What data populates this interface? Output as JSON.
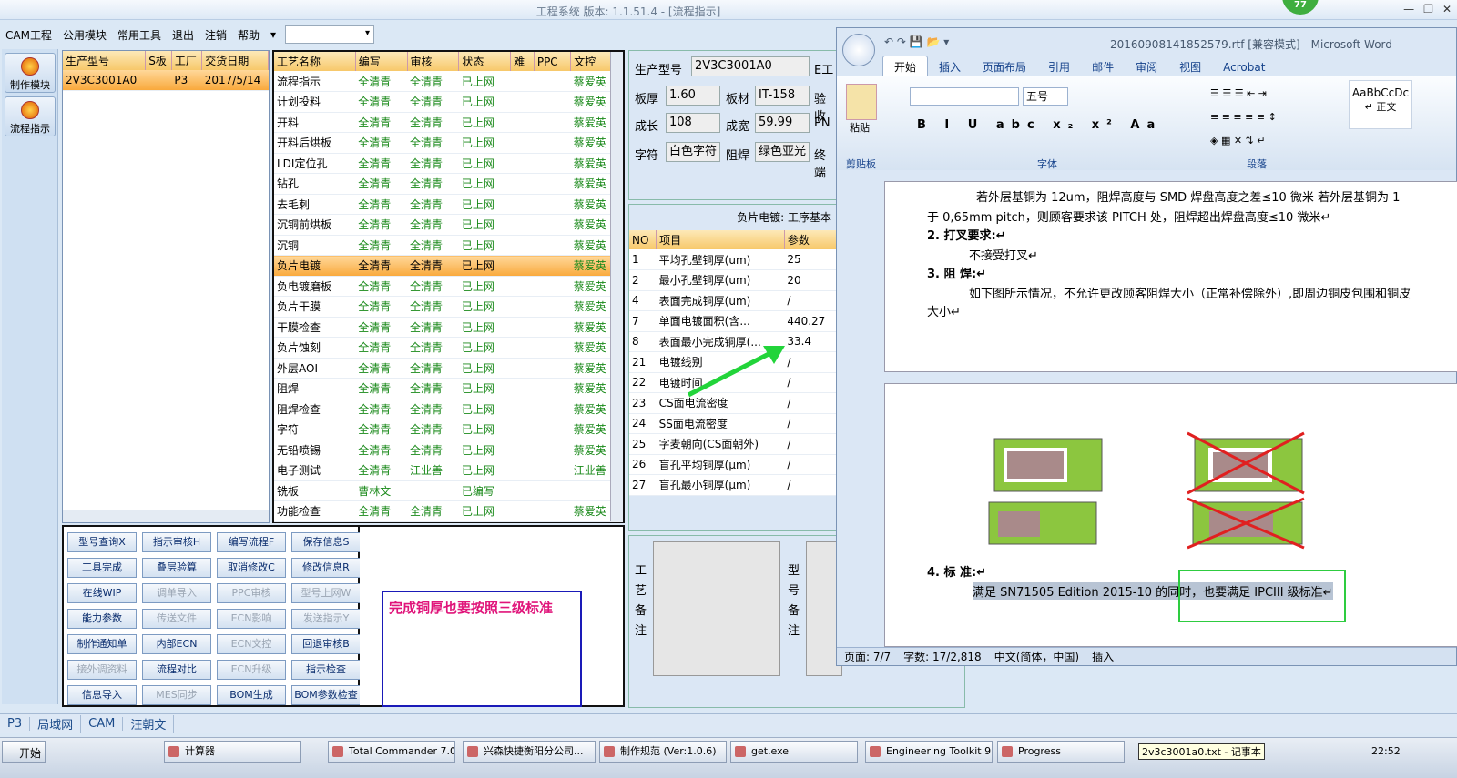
{
  "app": {
    "title": "工程系统  版本: 1.1.51.4 - [流程指示]",
    "badge": "77"
  },
  "menu": [
    "CAM工程",
    "公用模块",
    "常用工具",
    "退出",
    "注销",
    "帮助"
  ],
  "left_tools": [
    {
      "label": "制作模块"
    },
    {
      "label": "流程指示"
    }
  ],
  "model_table": {
    "headers": [
      "生产型号",
      "S板",
      "工厂",
      "交货日期"
    ],
    "row": [
      "2V3C3001A0",
      "",
      "P3",
      "2017/5/14"
    ]
  },
  "process_table": {
    "headers": [
      "工艺名称",
      "编写",
      "审核",
      "状态",
      "难",
      "PPC",
      "文控"
    ],
    "rows": [
      [
        "流程指示",
        "全清青",
        "全清青",
        "已上网",
        "",
        "",
        "蔡爱英"
      ],
      [
        "计划投料",
        "全清青",
        "全清青",
        "已上网",
        "",
        "",
        "蔡爱英"
      ],
      [
        "开料",
        "全清青",
        "全清青",
        "已上网",
        "",
        "",
        "蔡爱英"
      ],
      [
        "开料后烘板",
        "全清青",
        "全清青",
        "已上网",
        "",
        "",
        "蔡爱英"
      ],
      [
        "LDI定位孔",
        "全清青",
        "全清青",
        "已上网",
        "",
        "",
        "蔡爱英"
      ],
      [
        "钻孔",
        "全清青",
        "全清青",
        "已上网",
        "",
        "",
        "蔡爱英"
      ],
      [
        "去毛刺",
        "全清青",
        "全清青",
        "已上网",
        "",
        "",
        "蔡爱英"
      ],
      [
        "沉铜前烘板",
        "全清青",
        "全清青",
        "已上网",
        "",
        "",
        "蔡爱英"
      ],
      [
        "沉铜",
        "全清青",
        "全清青",
        "已上网",
        "",
        "",
        "蔡爱英"
      ],
      [
        "负片电镀",
        "全清青",
        "全清青",
        "已上网",
        "",
        "",
        "蔡爱英"
      ],
      [
        "负电镀磨板",
        "全清青",
        "全清青",
        "已上网",
        "",
        "",
        "蔡爱英"
      ],
      [
        "负片干膜",
        "全清青",
        "全清青",
        "已上网",
        "",
        "",
        "蔡爱英"
      ],
      [
        "干膜检查",
        "全清青",
        "全清青",
        "已上网",
        "",
        "",
        "蔡爱英"
      ],
      [
        "负片蚀刻",
        "全清青",
        "全清青",
        "已上网",
        "",
        "",
        "蔡爱英"
      ],
      [
        "外层AOI",
        "全清青",
        "全清青",
        "已上网",
        "",
        "",
        "蔡爱英"
      ],
      [
        "阻焊",
        "全清青",
        "全清青",
        "已上网",
        "",
        "",
        "蔡爱英"
      ],
      [
        "阻焊检查",
        "全清青",
        "全清青",
        "已上网",
        "",
        "",
        "蔡爱英"
      ],
      [
        "字符",
        "全清青",
        "全清青",
        "已上网",
        "",
        "",
        "蔡爱英"
      ],
      [
        "无铅喷锡",
        "全清青",
        "全清青",
        "已上网",
        "",
        "",
        "蔡爱英"
      ],
      [
        "电子测试",
        "全清青",
        "江业善",
        "已上网",
        "",
        "",
        "江业善"
      ],
      [
        "铣板",
        "曹林文",
        "",
        "已编写",
        "",
        "",
        ""
      ],
      [
        "功能检查",
        "全清青",
        "全清青",
        "已上网",
        "",
        "",
        "蔡爱英"
      ]
    ],
    "selected_index": 9
  },
  "buttons": [
    [
      "型号查询X",
      "指示审核H",
      "编写流程F",
      "保存信息S"
    ],
    [
      "工具完成",
      "叠层验算",
      "取消修改C",
      "修改信息R"
    ],
    [
      "在线WIP",
      "调单导入",
      "PPC审核",
      "型号上网W"
    ],
    [
      "能力参数",
      "传送文件",
      "ECN影响",
      "发送指示Y"
    ],
    [
      "制作通知单",
      "内部ECN",
      "ECN文控",
      "回退审核B"
    ],
    [
      "接外调资料",
      "流程对比",
      "ECN升级",
      "指示检查"
    ],
    [
      "信息导入",
      "MES同步",
      "BOM生成",
      "BOM参数检查"
    ]
  ],
  "disabled_buttons": [
    "调单导入",
    "PPC审核",
    "型号上网W",
    "传送文件",
    "ECN影响",
    "发送指示Y",
    "ECN文控",
    "接外调资料",
    "ECN升级",
    "MES同步"
  ],
  "note": "完成铜厚也要按照三级标准",
  "info": {
    "model_label": "生产型号",
    "model": "2V3C3001A0",
    "e_label": "E工",
    "thick_label": "板厚",
    "thick": "1.60",
    "mat_label": "板材",
    "mat": "IT-158",
    "check_label": "验收",
    "len_label": "成长",
    "len": "108",
    "wid_label": "成宽",
    "wid": "59.99",
    "pn_label": "PN",
    "char_label": "字符",
    "char": "白色字符",
    "mask_label": "阻焊",
    "mask": "绿色亚光",
    "end_label": "终端"
  },
  "param_table": {
    "caption": "负片电镀: 工序基本",
    "headers": [
      "NO",
      "项目",
      "参数"
    ],
    "rows": [
      [
        "1",
        "平均孔壁铜厚(um)",
        "25"
      ],
      [
        "2",
        "最小孔壁铜厚(um)",
        "20"
      ],
      [
        "4",
        "表面完成铜厚(um)",
        "/"
      ],
      [
        "7",
        "单面电镀面积(含...",
        "440.27"
      ],
      [
        "8",
        "表面最小完成铜厚(...",
        "33.4"
      ],
      [
        "21",
        "电镀线别",
        "/"
      ],
      [
        "22",
        "电镀时间",
        "/"
      ],
      [
        "23",
        "CS面电流密度",
        "/"
      ],
      [
        "24",
        "SS面电流密度",
        "/"
      ],
      [
        "25",
        "字麦朝向(CS面朝外)",
        "/"
      ],
      [
        "26",
        "盲孔平均铜厚(μm)",
        "/"
      ],
      [
        "27",
        "盲孔最小铜厚(μm)",
        "/"
      ]
    ]
  },
  "remarks": {
    "craft": "工艺备注",
    "model": "型号备注"
  },
  "word": {
    "title": "20160908141852579.rtf [兼容模式] - Microsoft Word",
    "tabs": [
      "开始",
      "插入",
      "页面布局",
      "引用",
      "邮件",
      "审阅",
      "视图",
      "Acrobat"
    ],
    "groups": [
      "剪贴板",
      "字体",
      "段落"
    ],
    "paste": "粘贴",
    "fontsize": "五号",
    "style": "AaBbCcDc",
    "style_name": "↵ 正文",
    "doc": [
      "若外层基铜为 12um，阻焊高度与 SMD 焊盘高度之差≤10 微米      若外层基铜为 1",
      "于 0,65mm pitch，则顾客要求该 PITCH 处，阻焊超出焊盘高度≤10 微米↵",
      "2.   打叉要求:↵",
      "不接受打叉↵",
      "3.   阻   焊:↵",
      "如下图所示情况，不允许更改顾客阻焊大小（正常补偿除外）,即周边铜皮包围和铜皮",
      "大小↵",
      "4.   标   准:↵",
      "满足 SN71505 Edition 2015-10 的同时，也要满足 IPCIII 级标准↵"
    ],
    "status": [
      "页面: 7/7",
      "字数: 17/2,818",
      "中文(简体，中国)",
      "插入"
    ]
  },
  "statusbar": [
    "P3",
    "局域网",
    "CAM",
    "汪朝文"
  ],
  "taskbar": {
    "start": "开始",
    "items": [
      "计算器",
      "Total Commander 7.0 ...",
      "兴森快捷衡阳分公司...",
      "制作规范 (Ver:1.0.6)",
      "get.exe",
      "Engineering Toolkit 9....",
      "Progress"
    ],
    "tooltip": "2v3c3001a0.txt - 记事本",
    "clock": "22:52"
  }
}
